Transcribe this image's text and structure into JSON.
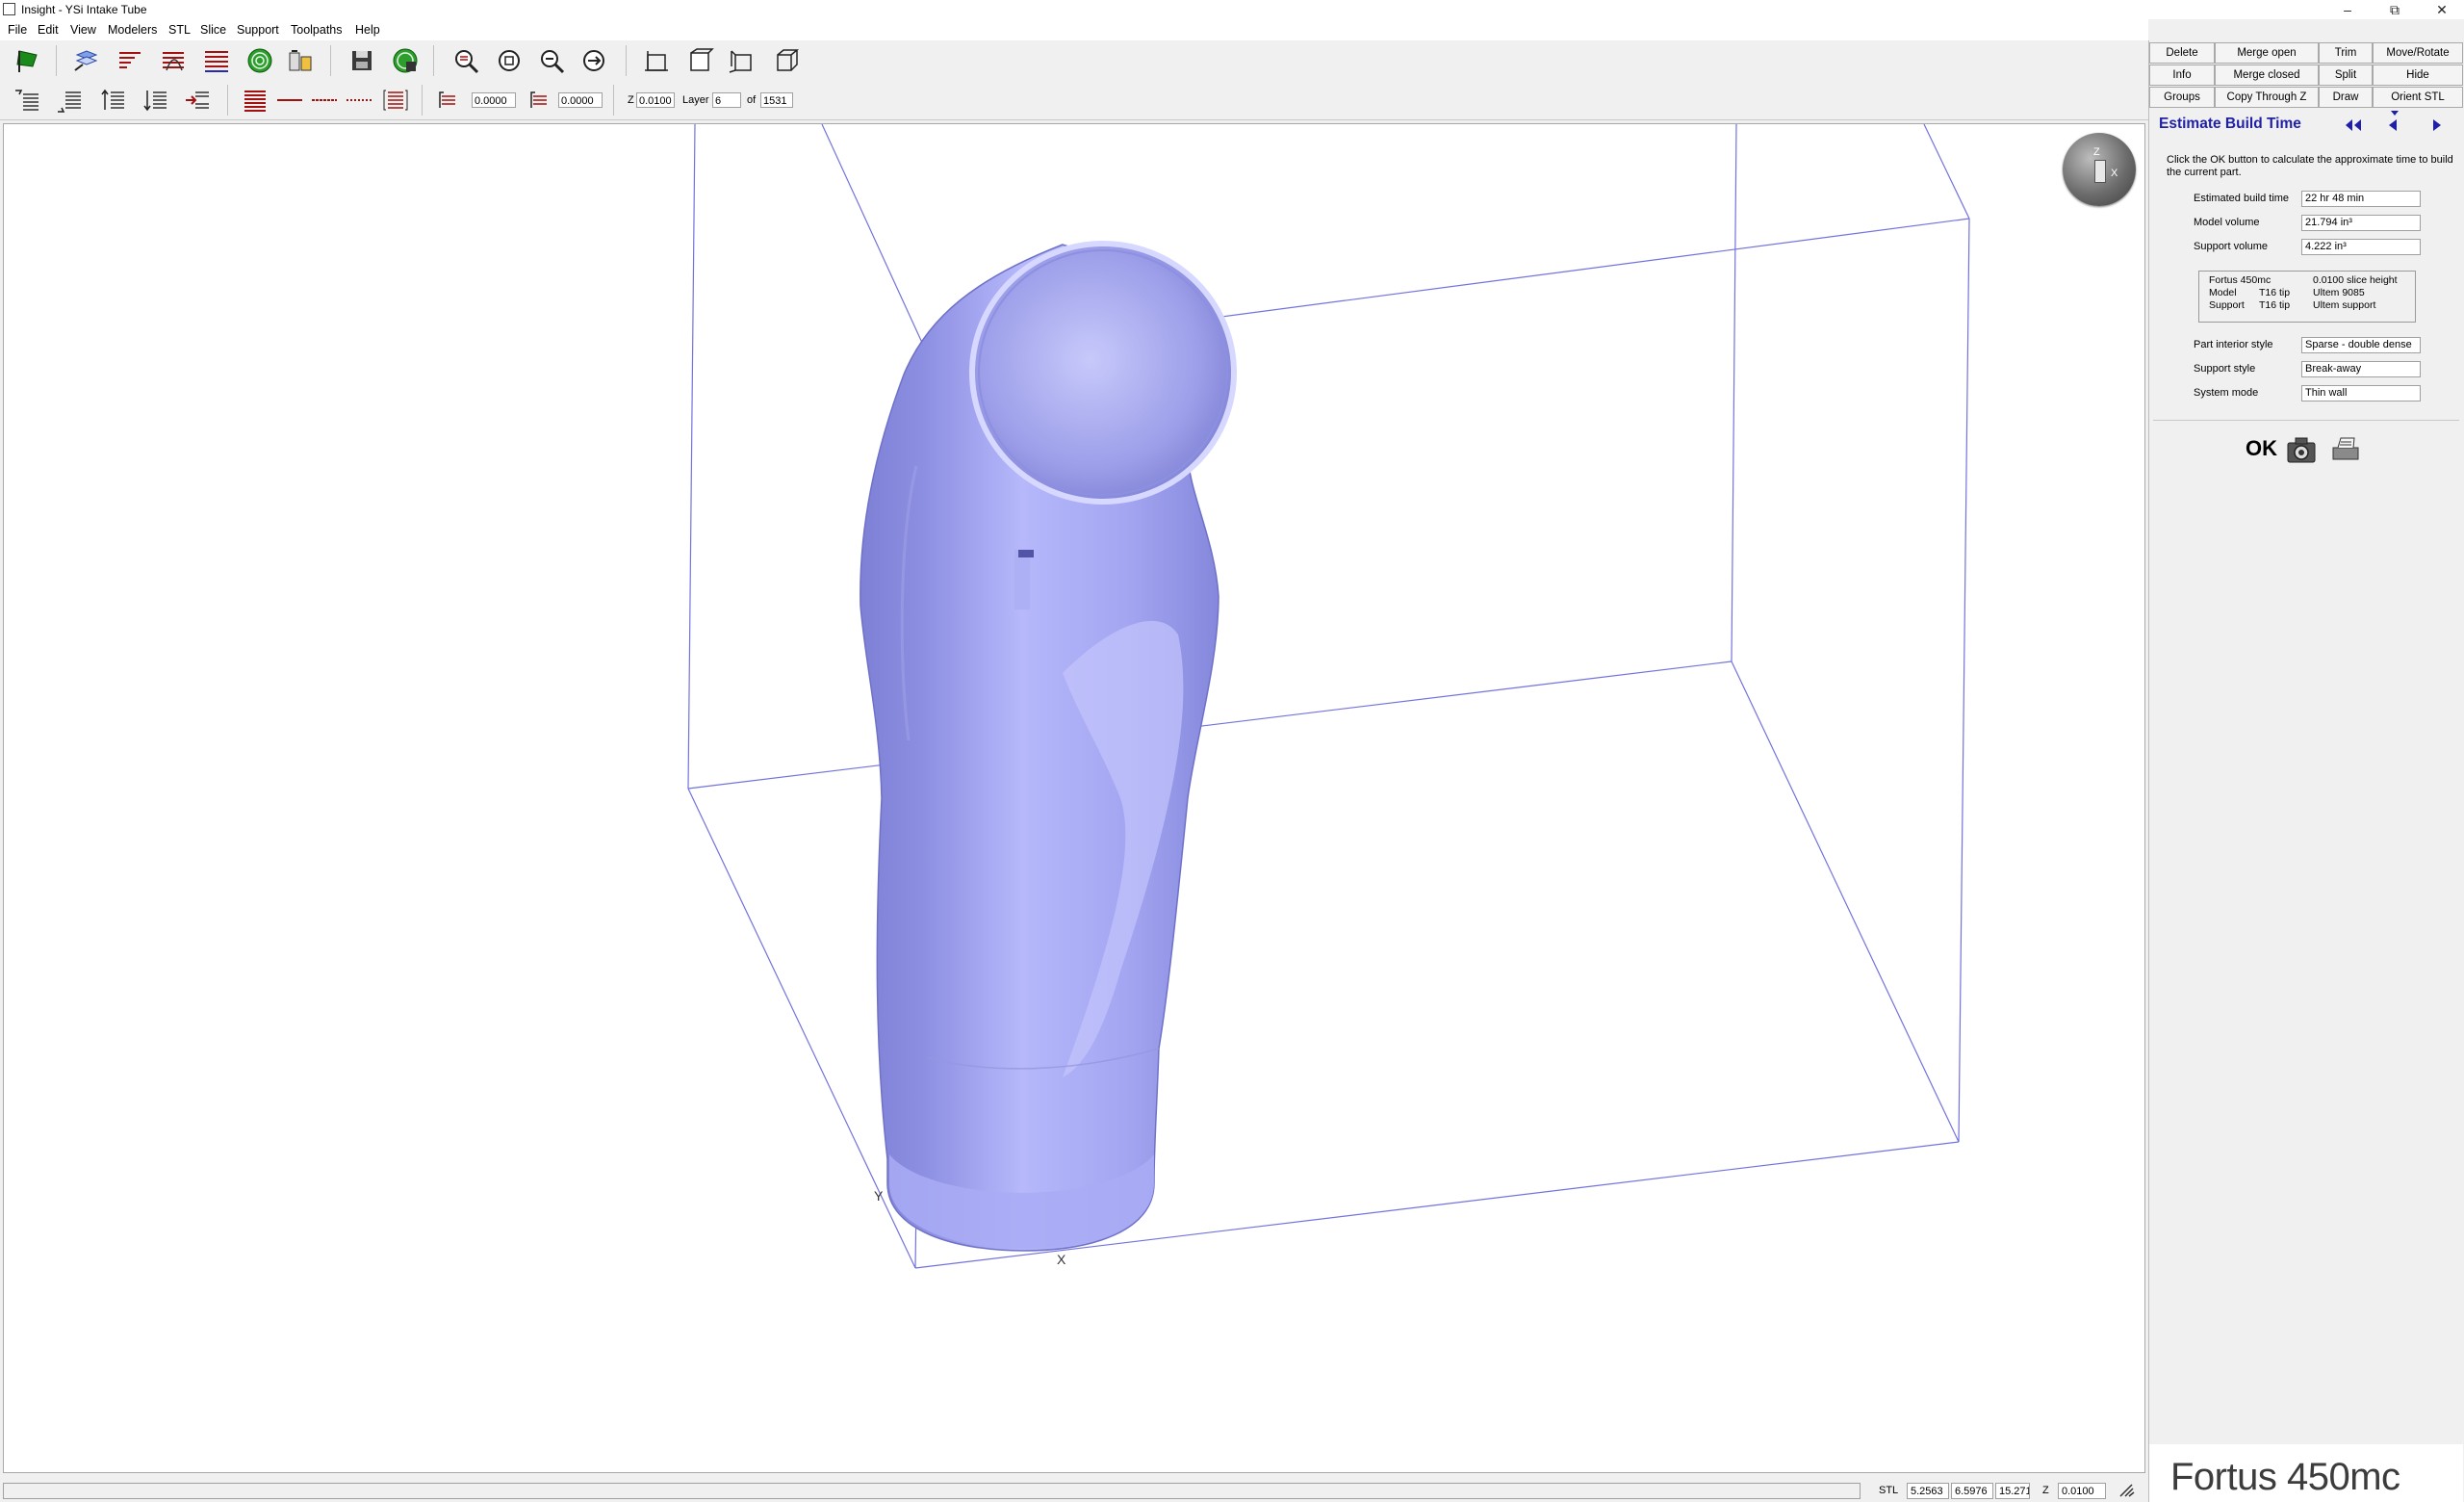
{
  "window": {
    "title": "Insight - YSi Intake Tube"
  },
  "menu": [
    "File",
    "Edit",
    "View",
    "Modelers",
    "STL",
    "Slice",
    "Support",
    "Toolpaths",
    "Help"
  ],
  "toolbar": {
    "x_offset": "0.0000",
    "y_offset": "0.0000",
    "z_label": "Z",
    "z_value": "0.0100",
    "layer_label": "Layer",
    "layer_value": "6",
    "of_label": "of",
    "total_layers": "1531"
  },
  "viewport": {
    "axis_x": "X",
    "axis_y": "Y",
    "axis_z": "Z",
    "model_color": "#a7a9f2",
    "box_color": "#5a5ad8"
  },
  "actions": [
    [
      "Delete",
      "Merge open",
      "Trim",
      "Move/Rotate"
    ],
    [
      "Info",
      "Merge closed",
      "Split",
      "Hide"
    ],
    [
      "Groups",
      "Copy Through Z",
      "Draw",
      "Orient STL"
    ]
  ],
  "panel": {
    "title": "Estimate Build Time",
    "title_color": "#1f1fa8",
    "description": "Click the OK button to calculate the approximate time to build the current part.",
    "rows_top": [
      {
        "label": "Estimated build time",
        "value": "22 hr 48 min"
      },
      {
        "label": "Model volume",
        "value": "21.794 in³"
      },
      {
        "label": "Support volume",
        "value": "4.222 in³"
      }
    ],
    "specs": {
      "machine": "Fortus 450mc",
      "slice_height": "0.0100 slice height",
      "model_label": "Model",
      "model_tip": "T16 tip",
      "model_material": "Ultem 9085",
      "support_label": "Support",
      "support_tip": "T16 tip",
      "support_material": "Ultem support"
    },
    "rows_bottom": [
      {
        "label": "Part interior style",
        "value": "Sparse - double dense"
      },
      {
        "label": "Support style",
        "value": "Break-away"
      },
      {
        "label": "System mode",
        "value": "Thin wall"
      }
    ],
    "ok_label": "OK"
  },
  "status": {
    "mode_label": "STL",
    "x": "5.2563",
    "y": "6.5976",
    "z": "15.2710",
    "z_label": "Z",
    "z_value": "0.0100"
  },
  "branding": {
    "logo_text": "Fortus 450mc"
  }
}
